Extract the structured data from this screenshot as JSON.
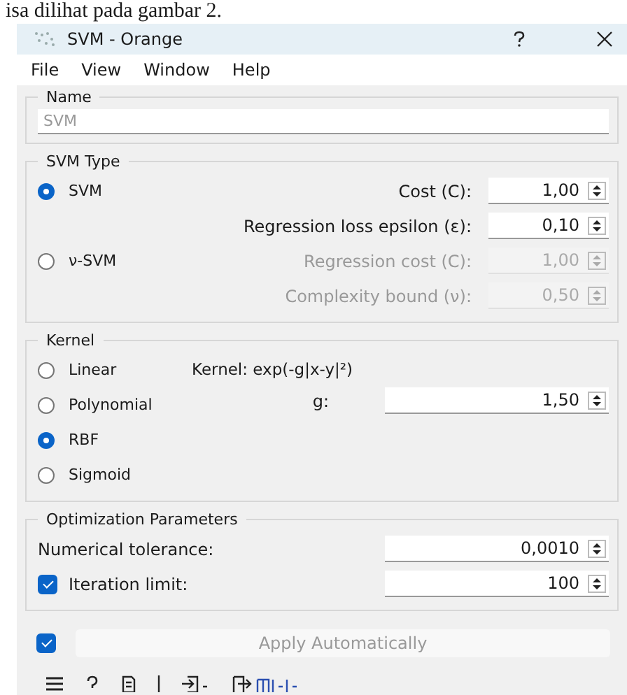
{
  "caption": "isa dilihat pada gambar 2.",
  "window": {
    "title": "SVM - Orange"
  },
  "menu": [
    "File",
    "View",
    "Window",
    "Help"
  ],
  "name_box": {
    "title": "Name",
    "placeholder": "SVM"
  },
  "svm_type": {
    "title": "SVM Type",
    "options": [
      {
        "label": "SVM",
        "selected": true
      },
      {
        "label": "ν-SVM",
        "selected": false
      }
    ],
    "params": [
      {
        "label": "Cost (C):",
        "value": "1,00",
        "disabled": false
      },
      {
        "label": "Regression loss epsilon (ε):",
        "value": "0,10",
        "disabled": false
      },
      {
        "label": "Regression cost (C):",
        "value": "1,00",
        "disabled": true
      },
      {
        "label": "Complexity bound (ν):",
        "value": "0,50",
        "disabled": true
      }
    ]
  },
  "kernel": {
    "title": "Kernel",
    "options": [
      {
        "label": "Linear",
        "selected": false
      },
      {
        "label": "Polynomial",
        "selected": false
      },
      {
        "label": "RBF",
        "selected": true
      },
      {
        "label": "Sigmoid",
        "selected": false
      }
    ],
    "formula": "Kernel: exp(-g|x-y|²)",
    "params": [
      {
        "label": "g:",
        "value": "1,50",
        "disabled": false
      }
    ]
  },
  "optimization": {
    "title": "Optimization Parameters",
    "rows": [
      {
        "kind": "plain",
        "label": "Numerical tolerance:",
        "value": "0,0010"
      },
      {
        "kind": "checkbox",
        "checked": true,
        "label": "Iteration limit:",
        "value": "100"
      }
    ]
  },
  "apply": {
    "checked": true,
    "label": "Apply Automatically",
    "disabled": true
  }
}
